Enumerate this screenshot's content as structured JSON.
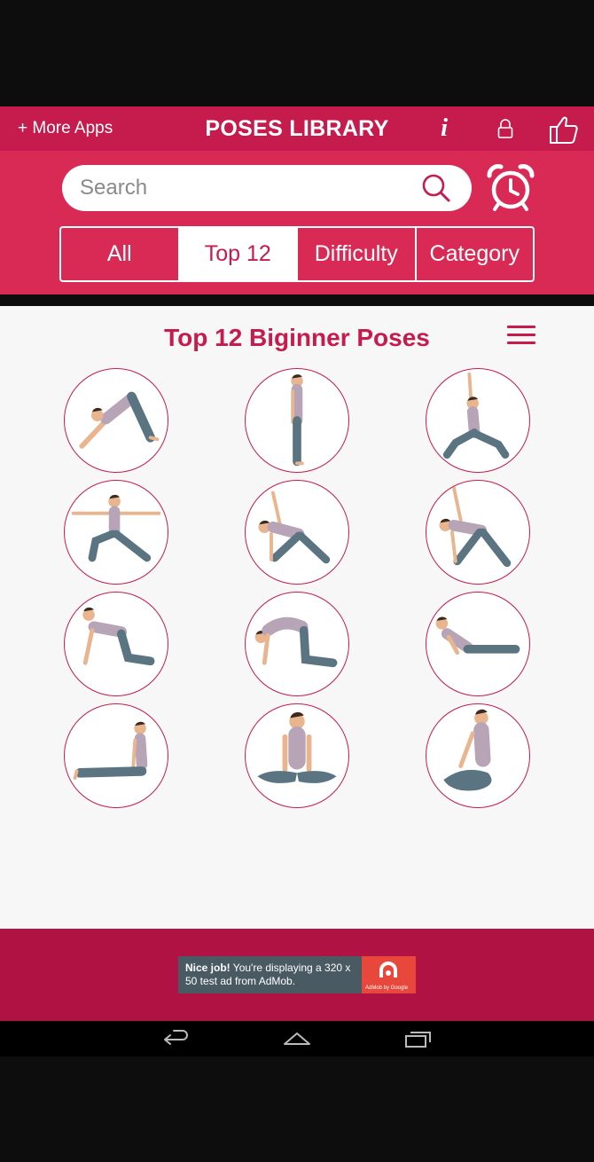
{
  "header": {
    "more_apps": "+ More Apps",
    "title": "POSES LIBRARY",
    "info_icon": "info-icon",
    "lock_icon": "lock-icon",
    "like_icon": "thumbs-up-icon"
  },
  "search": {
    "placeholder": "Search",
    "value": ""
  },
  "tabs": [
    {
      "label": "All",
      "active": false
    },
    {
      "label": "Top 12",
      "active": true
    },
    {
      "label": "Difficulty",
      "active": false
    },
    {
      "label": "Category",
      "active": false
    }
  ],
  "content": {
    "section_title": "Top 12 Biginner Poses",
    "poses": [
      {
        "icon": "downward-dog-pose"
      },
      {
        "icon": "mountain-pose"
      },
      {
        "icon": "warrior-one-pose"
      },
      {
        "icon": "warrior-two-pose"
      },
      {
        "icon": "triangle-pose"
      },
      {
        "icon": "extended-triangle-pose"
      },
      {
        "icon": "cow-pose"
      },
      {
        "icon": "cat-pose"
      },
      {
        "icon": "cobra-pose"
      },
      {
        "icon": "staff-pose"
      },
      {
        "icon": "bound-angle-pose"
      },
      {
        "icon": "easy-pose"
      }
    ]
  },
  "ad": {
    "bold": "Nice job!",
    "text": " You're displaying a 320 x 50 test ad from AdMob.",
    "brand": "AdMob by Google"
  },
  "colors": {
    "header": "#c51b4d",
    "panel": "#d92a55",
    "ad_bar": "#b01244",
    "accent": "#c51b4d"
  }
}
